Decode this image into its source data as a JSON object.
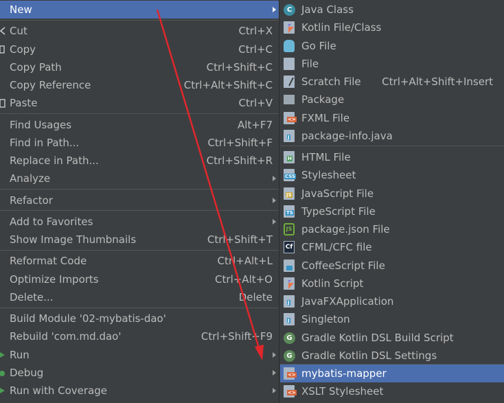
{
  "left_menu": {
    "items": [
      {
        "label": "New",
        "shortcut": "",
        "submenu": true,
        "selected": true
      },
      {
        "label": "Cut",
        "shortcut": "Ctrl+X",
        "submenu": false,
        "icon": "scissors-icon"
      },
      {
        "label": "Copy",
        "shortcut": "Ctrl+C",
        "submenu": false,
        "icon": "copy-icon"
      },
      {
        "label": "Copy Path",
        "shortcut": "Ctrl+Shift+C",
        "submenu": false
      },
      {
        "label": "Copy Reference",
        "shortcut": "Ctrl+Alt+Shift+C",
        "submenu": false
      },
      {
        "label": "Paste",
        "shortcut": "Ctrl+V",
        "submenu": false,
        "icon": "paste-icon"
      },
      {
        "label": "Find Usages",
        "shortcut": "Alt+F7",
        "submenu": false
      },
      {
        "label": "Find in Path...",
        "shortcut": "Ctrl+Shift+F",
        "submenu": false
      },
      {
        "label": "Replace in Path...",
        "shortcut": "Ctrl+Shift+R",
        "submenu": false
      },
      {
        "label": "Analyze",
        "shortcut": "",
        "submenu": true
      },
      {
        "label": "Refactor",
        "shortcut": "",
        "submenu": true
      },
      {
        "label": "Add to Favorites",
        "shortcut": "",
        "submenu": true
      },
      {
        "label": "Show Image Thumbnails",
        "shortcut": "Ctrl+Shift+T",
        "submenu": false
      },
      {
        "label": "Reformat Code",
        "shortcut": "Ctrl+Alt+L",
        "submenu": false
      },
      {
        "label": "Optimize Imports",
        "shortcut": "Ctrl+Alt+O",
        "submenu": false
      },
      {
        "label": "Delete...",
        "shortcut": "Delete",
        "submenu": false
      },
      {
        "label": "Build Module '02-mybatis-dao'",
        "shortcut": "",
        "submenu": false
      },
      {
        "label": "Rebuild 'com.md.dao'",
        "shortcut": "Ctrl+Shift+F9",
        "submenu": false
      },
      {
        "label": "Run",
        "shortcut": "",
        "submenu": true,
        "icon": "run-icon"
      },
      {
        "label": "Debug",
        "shortcut": "",
        "submenu": true,
        "icon": "debug-icon"
      },
      {
        "label": "Run with Coverage",
        "shortcut": "",
        "submenu": true,
        "icon": "coverage-icon"
      }
    ]
  },
  "right_menu": {
    "items": [
      {
        "label": "Java Class",
        "icon": "java-class-icon",
        "icon_text": "C"
      },
      {
        "label": "Kotlin File/Class",
        "icon": "kotlin-file-icon",
        "icon_text": ""
      },
      {
        "label": "Go File",
        "icon": "go-file-icon",
        "icon_text": ""
      },
      {
        "label": "File",
        "icon": "file-icon",
        "icon_text": ""
      },
      {
        "label": "Scratch File",
        "shortcut": "Ctrl+Alt+Shift+Insert",
        "icon": "scratch-file-icon",
        "icon_text": ""
      },
      {
        "label": "Package",
        "icon": "package-icon",
        "icon_text": ""
      },
      {
        "label": "FXML File",
        "icon": "fxml-file-icon",
        "icon_text": "<>"
      },
      {
        "label": "package-info.java",
        "icon": "package-info-icon",
        "icon_text": "J"
      },
      {
        "label": "HTML File",
        "icon": "html-file-icon",
        "icon_text": "H"
      },
      {
        "label": "Stylesheet",
        "icon": "stylesheet-icon",
        "icon_text": "CSS"
      },
      {
        "label": "JavaScript File",
        "icon": "javascript-file-icon",
        "icon_text": "JS"
      },
      {
        "label": "TypeScript File",
        "icon": "typescript-file-icon",
        "icon_text": "TS"
      },
      {
        "label": "package.json File",
        "icon": "package-json-icon",
        "icon_text": "JS"
      },
      {
        "label": "CFML/CFC file",
        "icon": "cfml-file-icon",
        "icon_text": "Cf"
      },
      {
        "label": "CoffeeScript File",
        "icon": "coffeescript-file-icon",
        "icon_text": ""
      },
      {
        "label": "Kotlin Script",
        "icon": "kotlin-script-icon",
        "icon_text": ""
      },
      {
        "label": "JavaFXApplication",
        "icon": "javafx-application-icon",
        "icon_text": "J"
      },
      {
        "label": "Singleton",
        "icon": "singleton-icon",
        "icon_text": "J"
      },
      {
        "label": "Gradle Kotlin DSL Build Script",
        "icon": "gradle-icon",
        "icon_text": "G"
      },
      {
        "label": "Gradle Kotlin DSL Settings",
        "icon": "gradle-icon",
        "icon_text": "G"
      },
      {
        "label": "mybatis-mapper",
        "icon": "mybatis-mapper-icon",
        "icon_text": "<>",
        "selected": true
      },
      {
        "label": "XSLT Stylesheet",
        "icon": "xslt-stylesheet-icon",
        "icon_text": "<>"
      }
    ]
  },
  "colors": {
    "background": "#3c3f41",
    "selection": "#4b6eaf",
    "text": "#bbbbbb",
    "separator": "#515658",
    "annotation_arrow": "#e0272c"
  }
}
